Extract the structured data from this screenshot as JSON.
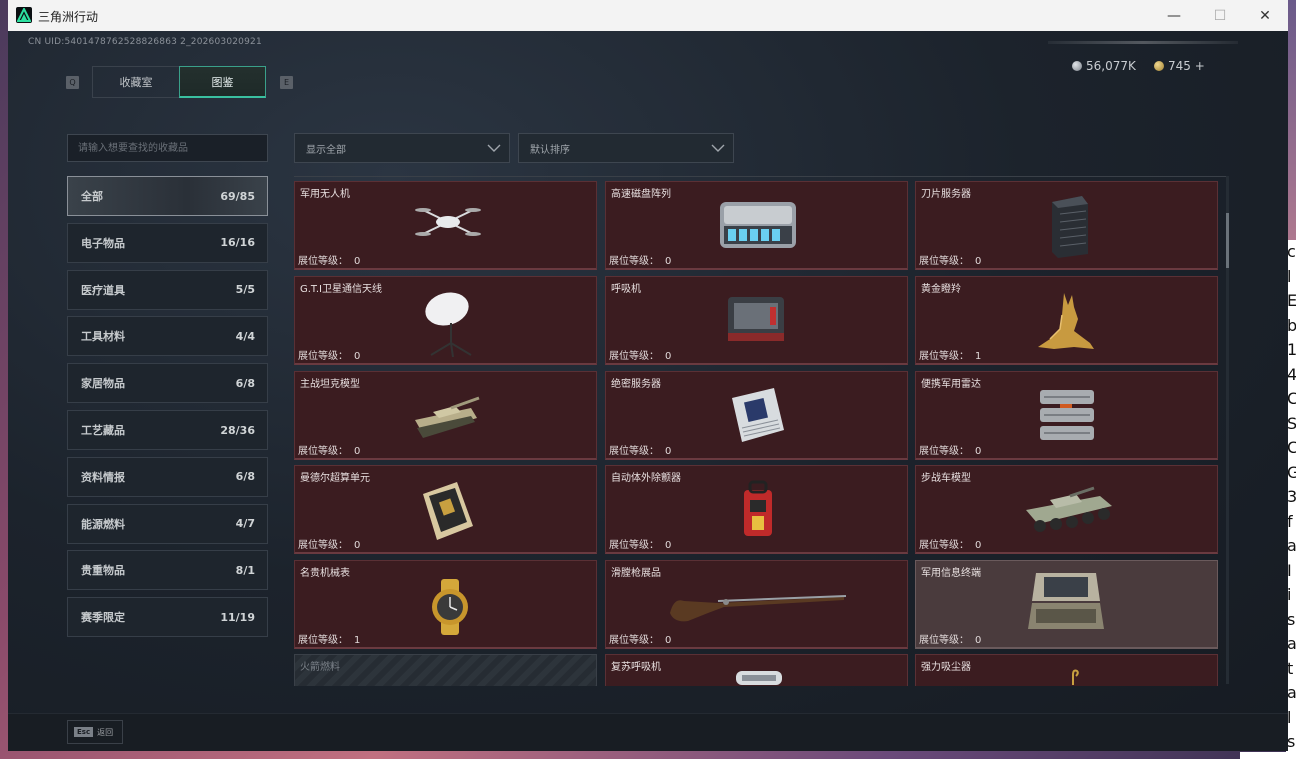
{
  "window": {
    "title": "三角洲行动",
    "buttons": {
      "minimize": "—",
      "maximize": "☐",
      "close": "✕"
    }
  },
  "header": {
    "uid": "CN UID:5401478762528826863 2_202603020921",
    "currency_silver": "56,077K",
    "currency_gold": "745 +"
  },
  "tabs": {
    "q_key": "Q",
    "e_key": "E",
    "items": [
      {
        "label": "收藏室"
      },
      {
        "label": "图鉴"
      }
    ]
  },
  "search": {
    "placeholder": "请输入想要查找的收藏品"
  },
  "filters": {
    "display": "显示全部",
    "sort": "默认排序"
  },
  "categories": [
    {
      "label": "全部",
      "count": "69/85"
    },
    {
      "label": "电子物品",
      "count": "16/16"
    },
    {
      "label": "医疗道具",
      "count": "5/5"
    },
    {
      "label": "工具材料",
      "count": "4/4"
    },
    {
      "label": "家居物品",
      "count": "6/8"
    },
    {
      "label": "工艺藏品",
      "count": "28/36"
    },
    {
      "label": "资料情报",
      "count": "6/8"
    },
    {
      "label": "能源燃料",
      "count": "4/7"
    },
    {
      "label": "贵重物品",
      "count": "8/1"
    },
    {
      "label": "赛季限定",
      "count": "11/19"
    }
  ],
  "level_label": "展位等级：",
  "items": [
    {
      "name": "军用无人机",
      "level": "0",
      "icon": "drone-icon"
    },
    {
      "name": "高速磁盘阵列",
      "level": "0",
      "icon": "disk-array-icon"
    },
    {
      "name": "刀片服务器",
      "level": "0",
      "icon": "blade-server-icon"
    },
    {
      "name": "G.T.I卫星通信天线",
      "level": "0",
      "icon": "satellite-antenna-icon"
    },
    {
      "name": "呼吸机",
      "level": "0",
      "icon": "ventilator-icon"
    },
    {
      "name": "黄金瞪羚",
      "level": "1",
      "icon": "golden-gazelle-icon"
    },
    {
      "name": "主战坦克模型",
      "level": "0",
      "icon": "tank-model-icon"
    },
    {
      "name": "绝密服务器",
      "level": "0",
      "icon": "secret-server-icon"
    },
    {
      "name": "便携军用雷达",
      "level": "0",
      "icon": "radar-icon"
    },
    {
      "name": "曼德尔超算单元",
      "level": "0",
      "icon": "supercomputer-icon"
    },
    {
      "name": "自动体外除颤器",
      "level": "0",
      "icon": "defibrillator-icon"
    },
    {
      "name": "步战车模型",
      "level": "0",
      "icon": "ifv-model-icon"
    },
    {
      "name": "名贵机械表",
      "level": "1",
      "icon": "watch-icon"
    },
    {
      "name": "滑膛枪展品",
      "level": "0",
      "icon": "musket-icon"
    },
    {
      "name": "军用信息终端",
      "level": "0",
      "icon": "terminal-icon"
    },
    {
      "name": "火箭燃料",
      "level": "",
      "icon": ""
    },
    {
      "name": "复苏呼吸机",
      "level": "",
      "icon": "resuscitator-icon"
    },
    {
      "name": "强力吸尘器",
      "level": "",
      "icon": "vacuum-icon"
    }
  ],
  "footer": {
    "esc_key": "Esc",
    "esc_label": "返回"
  }
}
